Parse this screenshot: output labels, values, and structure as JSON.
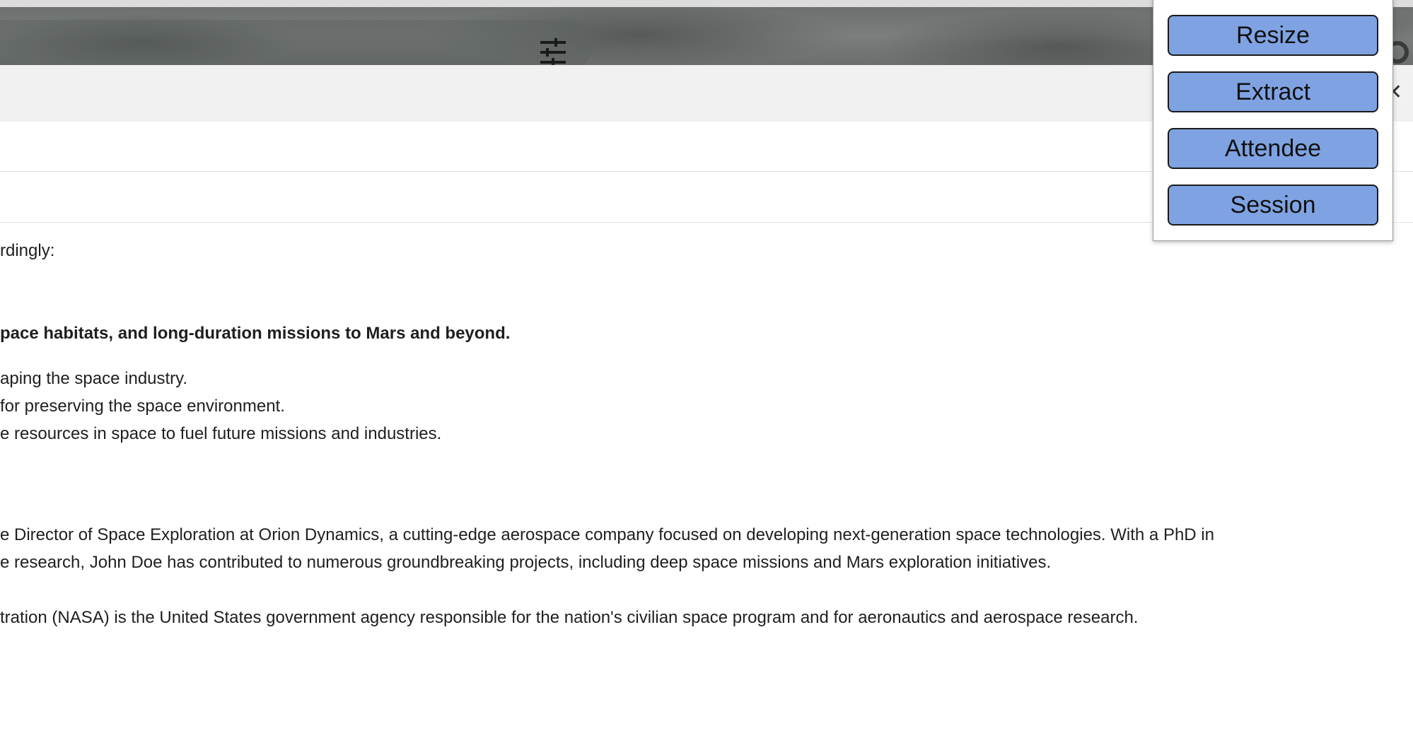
{
  "header": {
    "filter_icon": "tune-icon",
    "settings_icon": "gear-icon",
    "close_icon": "close-icon",
    "close_glyph": "✕"
  },
  "body": {
    "line1": "rdingly:",
    "bold_line": "pace habitats, and long-duration missions to Mars and beyond.",
    "bullets": [
      "aping the space industry.",
      "for preserving the space environment.",
      "e resources in space to fuel future missions and industries."
    ],
    "bio_line1": "e Director of Space Exploration at Orion Dynamics, a cutting-edge aerospace company focused on developing next-generation space technologies. With a PhD in",
    "bio_line2": "e research, John Doe has contributed to numerous groundbreaking projects, including deep space missions and Mars exploration initiatives.",
    "nasa_line": "tration (NASA) is the United States government agency responsible for the nation's civilian space program and for aeronautics and aerospace research."
  },
  "popup_menu": {
    "items": [
      "Resize",
      "Extract",
      "Attendee",
      "Session"
    ]
  },
  "colors": {
    "menu_button_bg": "#7fa3e2",
    "toolbar_bg": "#f1f1f1"
  }
}
